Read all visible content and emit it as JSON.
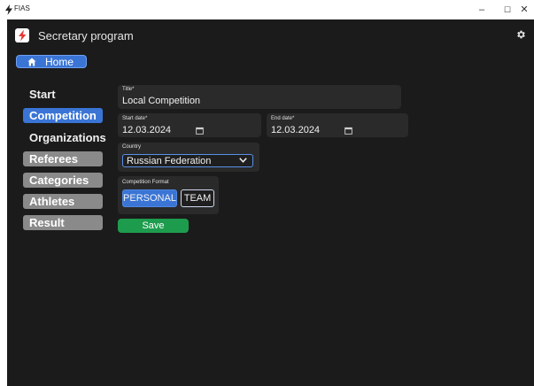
{
  "window": {
    "title": "FIAS",
    "controls": {
      "minimize": "–",
      "maximize": "☐",
      "close": "✕"
    }
  },
  "header": {
    "app_title": "Secretary program"
  },
  "home_button": {
    "label": "Home"
  },
  "sidebar": {
    "items": [
      {
        "label": "Start"
      },
      {
        "label": "Competition"
      },
      {
        "label": "Organizations"
      },
      {
        "label": "Referees"
      },
      {
        "label": "Categories"
      },
      {
        "label": "Athletes"
      },
      {
        "label": "Result"
      }
    ]
  },
  "form": {
    "title": {
      "label": "Title*",
      "value": "Local Competition"
    },
    "start_date": {
      "label": "Start date*",
      "value": "12.03.2024"
    },
    "end_date": {
      "label": "End date*",
      "value": "12.03.2024"
    },
    "country": {
      "label": "Country",
      "value": "Russian Federation"
    },
    "format": {
      "label": "Competition Format",
      "options": [
        "PERSONAL",
        "TEAM"
      ],
      "selected": "PERSONAL"
    },
    "save_label": "Save"
  },
  "colors": {
    "accent_blue": "#3a75d6",
    "save_green": "#1e9c4e",
    "inactive_gray": "#8a8a8a",
    "background": "#1b1b1b",
    "logo_red": "#e53935"
  },
  "icons": {
    "window_logo": "bolt-icon",
    "app_logo": "bolt-logo-icon",
    "settings": "gear-icon",
    "home": "home-icon",
    "calendar": "calendar-icon",
    "dropdown": "chevron-down-icon"
  }
}
